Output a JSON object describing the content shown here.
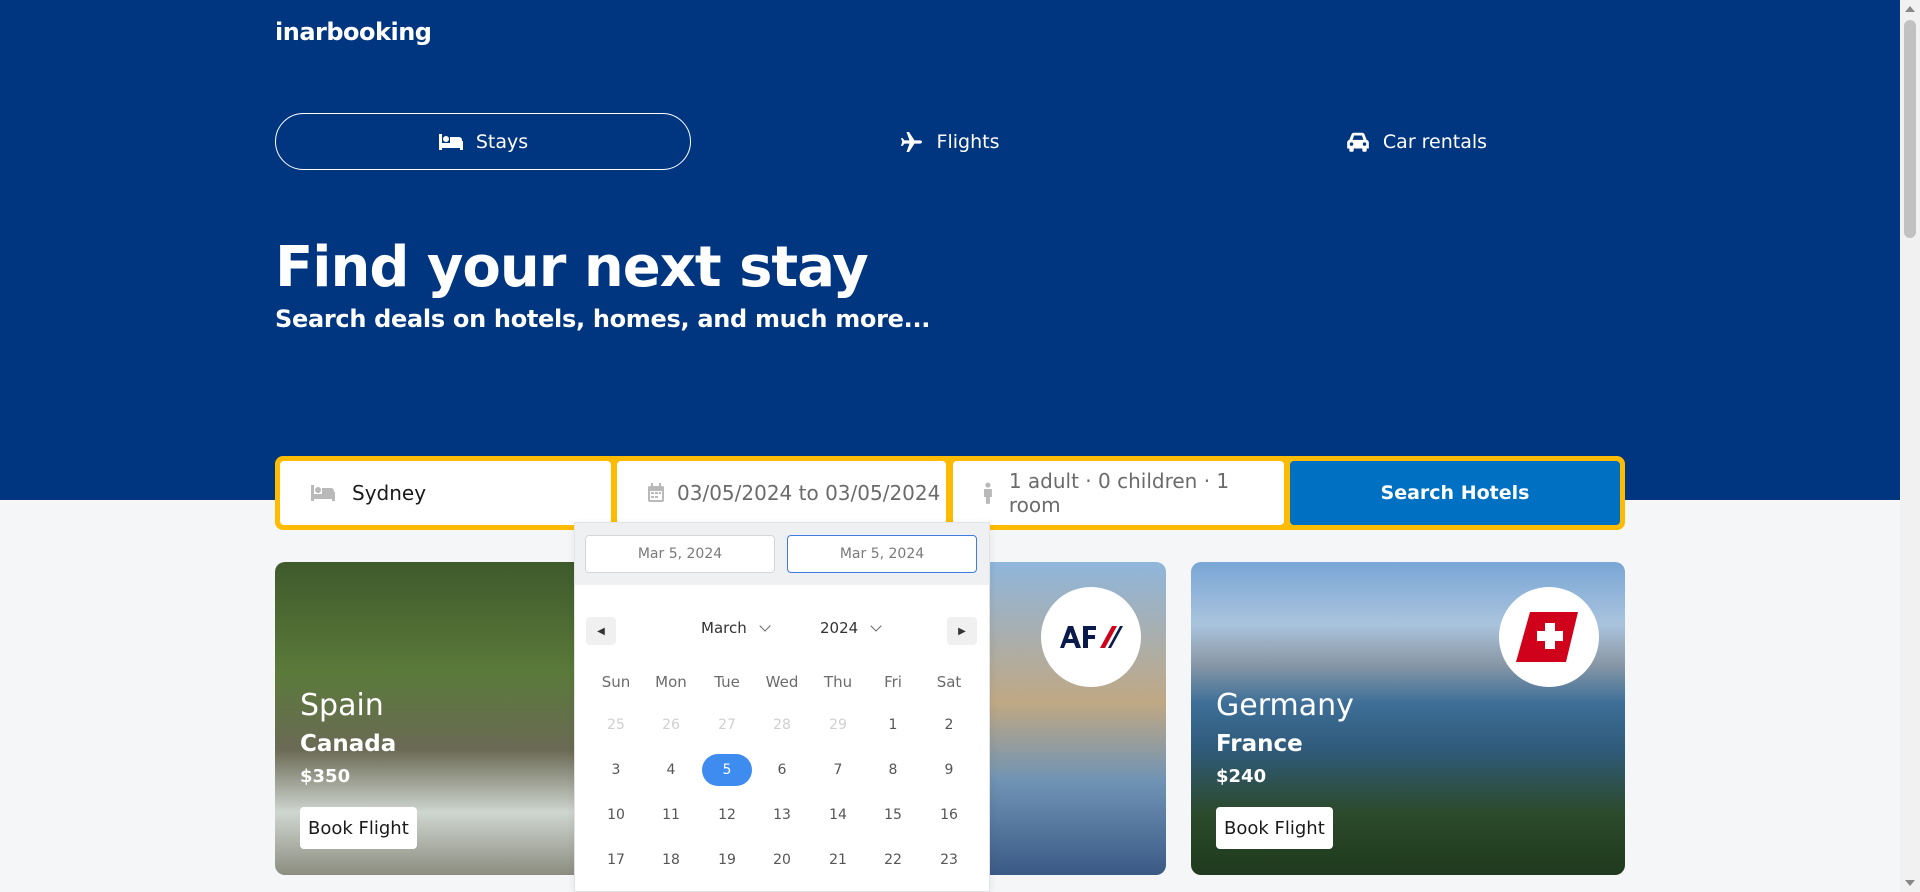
{
  "brand": "inarbooking",
  "tabs": [
    {
      "label": "Stays",
      "icon": "bed-icon",
      "active": true
    },
    {
      "label": "Flights",
      "icon": "plane-icon",
      "active": false
    },
    {
      "label": "Car rentals",
      "icon": "car-icon",
      "active": false
    }
  ],
  "hero": {
    "title": "Find your next stay",
    "subtitle": "Search deals on hotels, homes, and much more..."
  },
  "search": {
    "destination": "Sydney",
    "dates": "03/05/2024 to 03/05/2024",
    "guests": "1 adult · 0 children · 1 room",
    "button": "Search Hotels"
  },
  "calendar": {
    "start_input": "Mar 5, 2024",
    "end_input": "Mar 5, 2024",
    "month": "March",
    "year": "2024",
    "weekdays": [
      "Sun",
      "Mon",
      "Tue",
      "Wed",
      "Thu",
      "Fri",
      "Sat"
    ],
    "weeks": [
      [
        "25",
        "26",
        "27",
        "28",
        "29",
        "1",
        "2"
      ],
      [
        "3",
        "4",
        "5",
        "6",
        "7",
        "8",
        "9"
      ],
      [
        "10",
        "11",
        "12",
        "13",
        "14",
        "15",
        "16"
      ],
      [
        "17",
        "18",
        "19",
        "20",
        "21",
        "22",
        "23"
      ]
    ],
    "selected_day": "5"
  },
  "cards": [
    {
      "from": "Spain",
      "to": "Canada",
      "price": "$350",
      "button": "Book Flight",
      "logo": "none"
    },
    {
      "from": "",
      "to": "",
      "price": "",
      "button": "",
      "logo": "air-france-logo"
    },
    {
      "from": "Germany",
      "to": "France",
      "price": "$240",
      "button": "Book Flight",
      "logo": "swiss-airlines-logo"
    }
  ],
  "colors": {
    "hero_bg": "#003580",
    "search_border": "#febb02",
    "search_button": "#0071c2",
    "selected_day": "#3e8cf0"
  }
}
